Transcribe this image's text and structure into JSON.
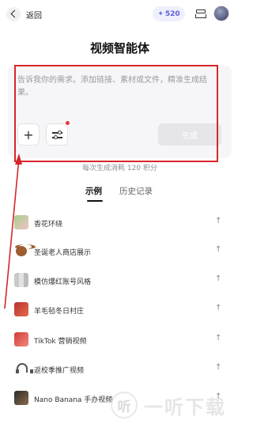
{
  "header": {
    "back_label": "返回",
    "credits": "520",
    "credits_icon": "sparkle-icon"
  },
  "title": "视频智能体",
  "prompt": {
    "placeholder": "告诉我你的需求。添加链接、素材或文件，精准生成结果。",
    "add_icon": "plus-icon",
    "settings_icon": "sliders-icon",
    "generate_label": "生成"
  },
  "cost_note": "每次生成消耗 120 积分",
  "tabs": {
    "examples": "示例",
    "history": "历史记录"
  },
  "examples": [
    {
      "label": "香花环绕",
      "thumb": "flower-thumbnail"
    },
    {
      "label": "圣诞老人商店展示",
      "thumb": "teddy-bear-thumbnail"
    },
    {
      "label": "模仿爆红账号风格",
      "thumb": "grid-thumbnail"
    },
    {
      "label": "羊毛毡冬日村庄",
      "thumb": "village-thumbnail"
    },
    {
      "label": "TikTok 营销视频",
      "thumb": "tiktok-thumbnail"
    },
    {
      "label": "返校季推广视频",
      "thumb": "headphone-icon"
    },
    {
      "label": "Nano Banana 手办视频",
      "thumb": "figurine-thumbnail"
    }
  ],
  "watermark": {
    "logo_text": "听",
    "text": "一听下载"
  },
  "colors": {
    "accent": "#5b5fe0",
    "annotation_red": "#d8252a",
    "notification_dot": "#e83a3a"
  }
}
